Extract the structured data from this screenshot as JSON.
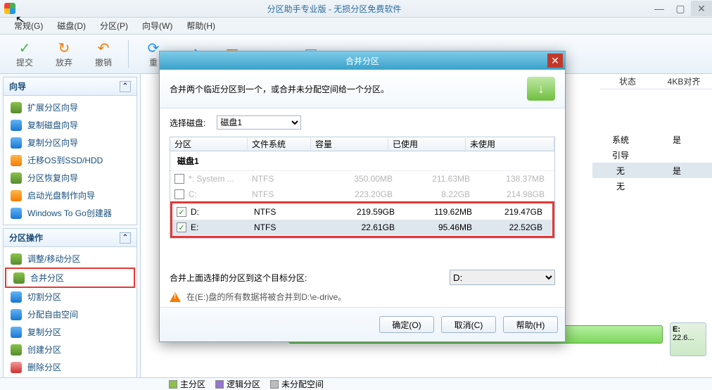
{
  "titlebar": {
    "title": "分区助手专业版 - 无损分区免费软件"
  },
  "menu": {
    "items": [
      "常规(G)",
      "磁盘(D)",
      "分区(P)",
      "向导(W)",
      "帮助(H)"
    ]
  },
  "toolbar": {
    "items": [
      {
        "icon": "✓",
        "label": "提交",
        "color": "#4caf50"
      },
      {
        "icon": "↻",
        "label": "放弃",
        "color": "#f57c00"
      },
      {
        "icon": "↶",
        "label": "撤销",
        "color": "#f57c00"
      },
      {
        "sep": true
      },
      {
        "icon": "⟳",
        "label": "重",
        "color": "#2196f3"
      },
      {
        "icon": "⇄",
        "label": "",
        "color": "#2196f3"
      },
      {
        "icon": "▥",
        "label": "",
        "color": "#f57c00"
      },
      {
        "icon": "◔",
        "label": "",
        "color": "#4caf50"
      },
      {
        "icon": "▤",
        "label": "",
        "color": "#42a5f5"
      }
    ]
  },
  "sidebar": {
    "panel1": {
      "title": "向导",
      "items": [
        {
          "icon": "si-green",
          "label": "扩展分区向导"
        },
        {
          "icon": "si-blue",
          "label": "复制磁盘向导"
        },
        {
          "icon": "si-blue",
          "label": "复制分区向导"
        },
        {
          "icon": "si-orange",
          "label": "迁移OS到SSD/HDD"
        },
        {
          "icon": "si-green",
          "label": "分区恢复向导"
        },
        {
          "icon": "si-orange",
          "label": "启动光盘制作向导"
        },
        {
          "icon": "si-blue",
          "label": "Windows To Go创建器"
        }
      ]
    },
    "panel2": {
      "title": "分区操作",
      "items": [
        {
          "icon": "si-green",
          "label": "调整/移动分区"
        },
        {
          "icon": "si-green",
          "label": "合并分区",
          "selected": true
        },
        {
          "icon": "si-blue",
          "label": "切割分区"
        },
        {
          "icon": "si-blue",
          "label": "分配自由空间"
        },
        {
          "icon": "si-blue",
          "label": "复制分区"
        },
        {
          "icon": "si-green",
          "label": "创建分区"
        },
        {
          "icon": "si-red",
          "label": "删除分区"
        }
      ]
    }
  },
  "rightTable": {
    "headers": [
      "状态",
      "4KB对齐"
    ],
    "rows": [
      {
        "c1": "系统",
        "c2": "是"
      },
      {
        "c1": "引导",
        "c2": ""
      },
      {
        "c1": "无",
        "c2": "是",
        "hl": true
      },
      {
        "c1": "无",
        "c2": ""
      }
    ]
  },
  "diskBar": {
    "label": "E:",
    "sub": "22.6..."
  },
  "legend": {
    "items": [
      {
        "cls": "bx-green",
        "label": "主分区"
      },
      {
        "cls": "bx-purple",
        "label": "逻辑分区"
      },
      {
        "cls": "bx-gray",
        "label": "未分配空间"
      }
    ]
  },
  "dialog": {
    "title": "合并分区",
    "desc": "合并两个临近分区到一个，或合并未分配空间给一个分区。",
    "selectDiskLabel": "选择磁盘:",
    "selectDiskValue": "磁盘1",
    "th": [
      "分区",
      "文件系统",
      "容量",
      "已使用",
      "未使用"
    ],
    "group": "磁盘1",
    "rows": [
      {
        "cb": false,
        "name": "*: System ...",
        "fs": "NTFS",
        "cap": "350.00MB",
        "used": "211.63MB",
        "free": "138.37MB",
        "dim": true
      },
      {
        "cb": false,
        "name": "C:",
        "fs": "NTFS",
        "cap": "223.20GB",
        "used": "8.22GB",
        "free": "214.98GB",
        "dim": true
      },
      {
        "cb": true,
        "name": "D:",
        "fs": "NTFS",
        "cap": "219.59GB",
        "used": "119.62MB",
        "free": "219.47GB",
        "hl": true
      },
      {
        "cb": true,
        "name": "E:",
        "fs": "NTFS",
        "cap": "22.61GB",
        "used": "95.46MB",
        "free": "22.52GB",
        "hl": true,
        "sel": true
      }
    ],
    "targetLabel": "合并上面选择的分区到这个目标分区:",
    "targetValue": "D:",
    "warnText": "在(E:)盘的所有数据将被合并到D:\\e-drive。",
    "buttons": {
      "ok": "确定(O)",
      "cancel": "取消(C)",
      "help": "帮助(H)"
    }
  }
}
